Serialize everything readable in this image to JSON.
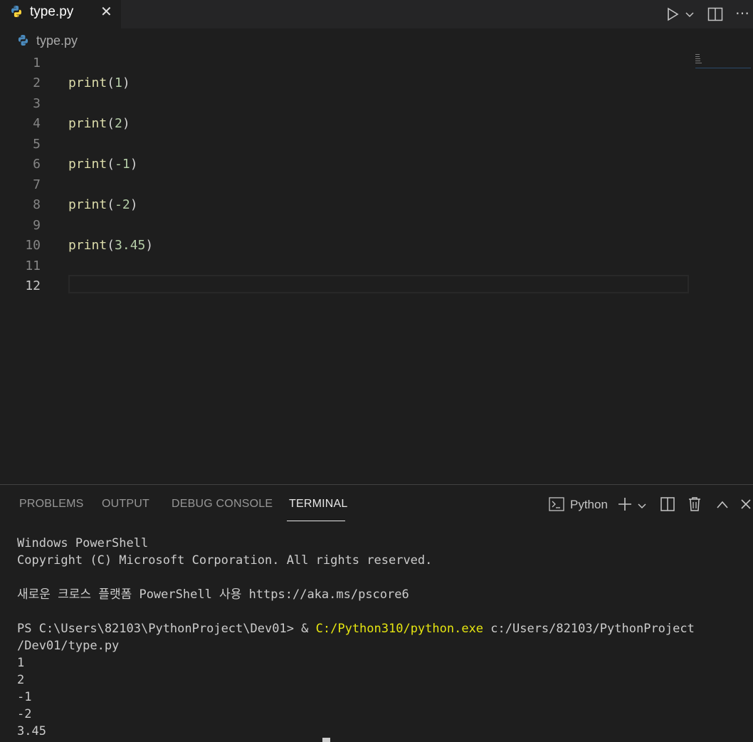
{
  "tab": {
    "label": "type.py",
    "close": "✕"
  },
  "breadcrumb": {
    "file": "type.py"
  },
  "editor": {
    "lines": [
      {
        "num": "1",
        "fn": "",
        "open": "",
        "arg": "",
        "close": ""
      },
      {
        "num": "2",
        "fn": "print",
        "open": "(",
        "arg": "1",
        "close": ")"
      },
      {
        "num": "3",
        "fn": "",
        "open": "",
        "arg": "",
        "close": ""
      },
      {
        "num": "4",
        "fn": "print",
        "open": "(",
        "arg": "2",
        "close": ")"
      },
      {
        "num": "5",
        "fn": "",
        "open": "",
        "arg": "",
        "close": ""
      },
      {
        "num": "6",
        "fn": "print",
        "open": "(",
        "arg": "-1",
        "close": ")"
      },
      {
        "num": "7",
        "fn": "",
        "open": "",
        "arg": "",
        "close": ""
      },
      {
        "num": "8",
        "fn": "print",
        "open": "(",
        "arg": "-2",
        "close": ")"
      },
      {
        "num": "9",
        "fn": "",
        "open": "",
        "arg": "",
        "close": ""
      },
      {
        "num": "10",
        "fn": "print",
        "open": "(",
        "arg": "3.45",
        "close": ")"
      },
      {
        "num": "11",
        "fn": "",
        "open": "",
        "arg": "",
        "close": ""
      },
      {
        "num": "12",
        "fn": "",
        "open": "",
        "arg": "",
        "close": ""
      }
    ]
  },
  "panel": {
    "tabs": {
      "problems": "PROBLEMS",
      "output": "OUTPUT",
      "debug": "DEBUG CONSOLE",
      "terminal": "TERMINAL"
    },
    "terminal_profile": "Python"
  },
  "terminal": {
    "l1": "Windows PowerShell",
    "l2": "Copyright (C) Microsoft Corporation. All rights reserved.",
    "l3": "새로운 크로스 플랫폼 PowerShell 사용 https://aka.ms/pscore6",
    "prompt": "PS C:\\Users\\82103\\PythonProject\\Dev01> & ",
    "exe": "C:/Python310/python.exe",
    "script": " c:/Users/82103/PythonProject",
    "script_cont": "/Dev01/type.py",
    "out1": "1",
    "out2": "2",
    "out3": "-1",
    "out4": "-2",
    "out5": "3.45"
  }
}
